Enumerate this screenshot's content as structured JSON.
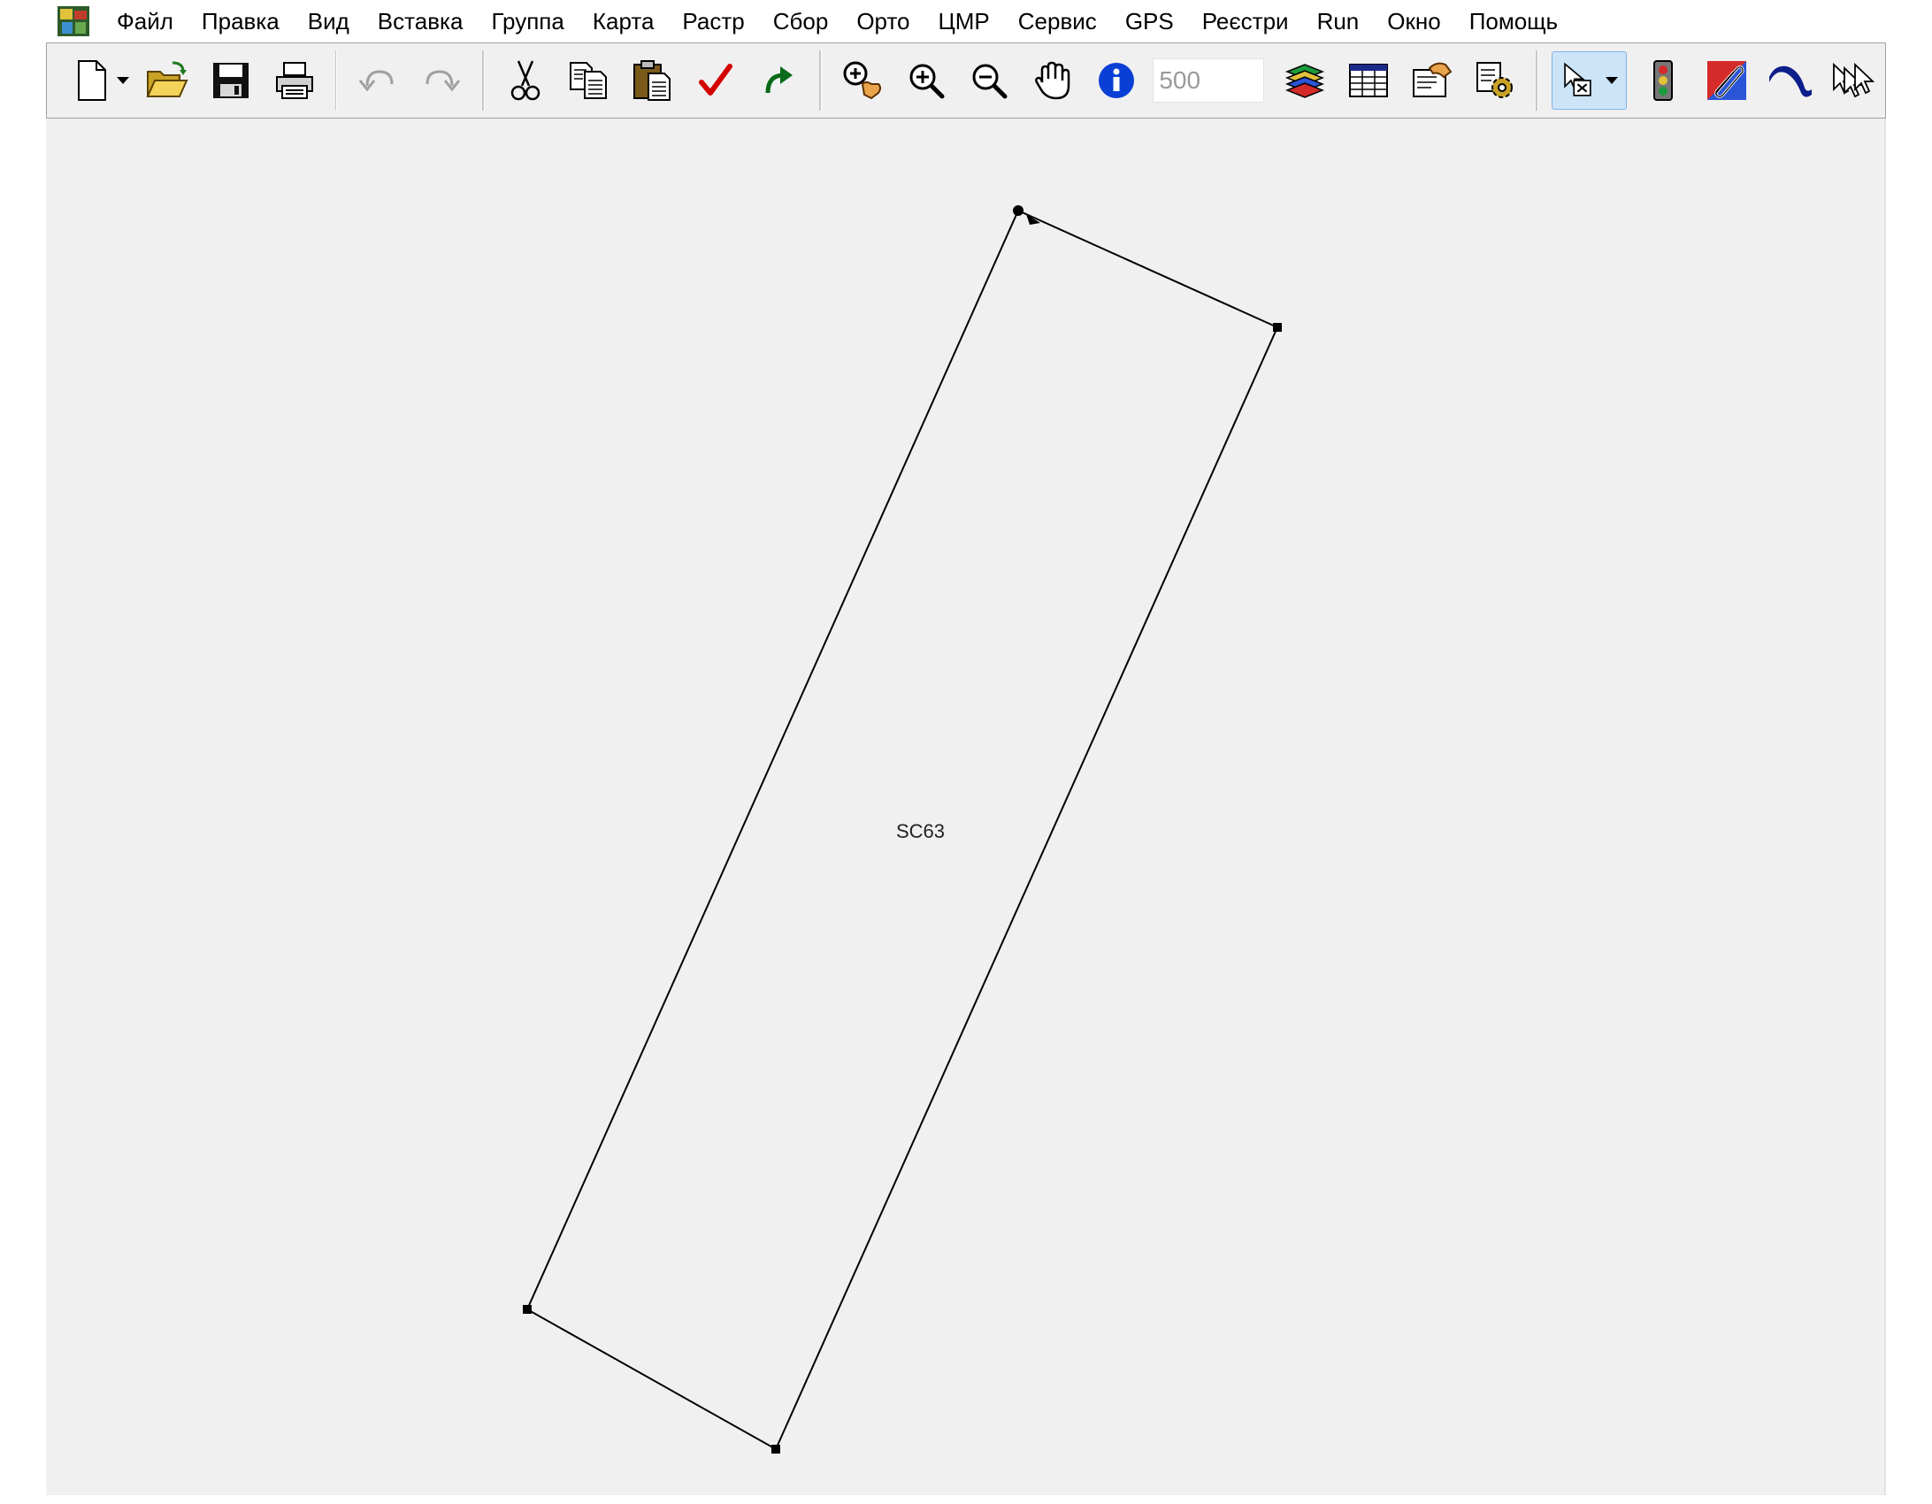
{
  "menu": {
    "items": [
      "Файл",
      "Правка",
      "Вид",
      "Вставка",
      "Группа",
      "Карта",
      "Растр",
      "Сбор",
      "Орто",
      "ЦМР",
      "Сервис",
      "GPS",
      "Реєстри",
      "Run",
      "Окно",
      "Помощь"
    ]
  },
  "toolbar": {
    "scale_value": "500",
    "icons": [
      "new-file-icon",
      "open-folder-icon",
      "save-icon",
      "print-icon",
      "undo-icon",
      "redo-icon",
      "cut-icon",
      "copy-icon",
      "paste-icon",
      "checkmark-icon",
      "redo-arrow-icon",
      "zoom-hand-icon",
      "zoom-in-icon",
      "zoom-out-icon",
      "pan-hand-icon",
      "info-icon",
      "layers-icon",
      "table-icon",
      "folder-hand-icon",
      "gear-settings-icon",
      "select-cursor-icon",
      "traffic-light-icon",
      "paperclip-icon",
      "curve-icon",
      "multi-arrow-icon"
    ]
  },
  "map": {
    "feature_label": "SC63"
  },
  "colors": {
    "canvas_bg": "#f0f0f0",
    "toolbar_bg": "#f0f0f0",
    "info_blue": "#0a3fd6",
    "check_red": "#d40000"
  }
}
